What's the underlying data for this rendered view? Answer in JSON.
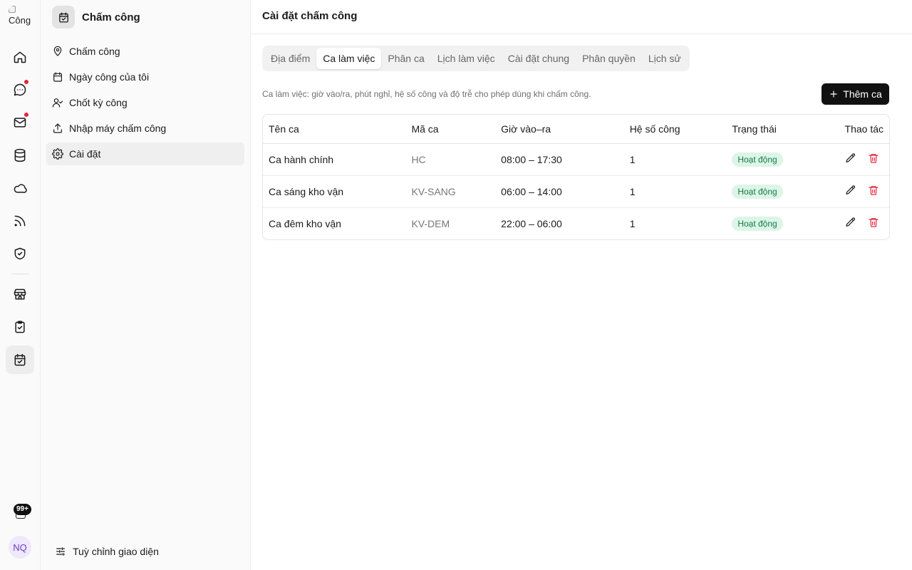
{
  "rail": {
    "logo_alt": "Công",
    "items": [
      {
        "icon": "home-icon"
      },
      {
        "icon": "chat-icon",
        "has_dot": true
      },
      {
        "icon": "mail-icon",
        "has_dot": true
      },
      {
        "icon": "database-icon"
      },
      {
        "icon": "cloud-icon"
      },
      {
        "icon": "rss-icon"
      },
      {
        "icon": "shield-check-icon"
      },
      {
        "icon": "store-icon"
      },
      {
        "icon": "clipboard-check-icon"
      },
      {
        "icon": "calendar-check-icon",
        "active": true
      }
    ],
    "notification_badge": "99+",
    "avatar_initials": "NQ"
  },
  "sidebar": {
    "title": "Chấm công",
    "items": [
      {
        "label": "Chấm công",
        "icon": "map-pin-icon"
      },
      {
        "label": "Ngày công của tôi",
        "icon": "calendar-icon"
      },
      {
        "label": "Chốt kỳ công",
        "icon": "user-check-icon"
      },
      {
        "label": "Nhập máy chấm công",
        "icon": "upload-icon"
      },
      {
        "label": "Cài đặt",
        "icon": "gear-icon",
        "active": true
      }
    ],
    "footer_label": "Tuỳ chỉnh giao diện"
  },
  "main": {
    "title": "Cài đặt chấm công",
    "tabs": [
      {
        "label": "Địa điểm"
      },
      {
        "label": "Ca làm việc",
        "active": true
      },
      {
        "label": "Phân ca"
      },
      {
        "label": "Lịch làm việc"
      },
      {
        "label": "Cài đặt chung"
      },
      {
        "label": "Phân quyền"
      },
      {
        "label": "Lịch sử"
      }
    ],
    "description": "Ca làm việc: giờ vào/ra, phút nghỉ, hệ số công và độ trễ cho phép dùng khi chấm công.",
    "add_button": "Thêm ca",
    "table": {
      "columns": [
        "Tên ca",
        "Mã ca",
        "Giờ vào–ra",
        "Hệ số công",
        "Trạng thái",
        "Thao tác"
      ],
      "rows": [
        {
          "name": "Ca hành chính",
          "code": "HC",
          "hours": "08:00 – 17:30",
          "factor": "1",
          "status": "Hoạt động"
        },
        {
          "name": "Ca sáng kho vận",
          "code": "KV-SANG",
          "hours": "06:00 – 14:00",
          "factor": "1",
          "status": "Hoạt động"
        },
        {
          "name": "Ca đêm kho vận",
          "code": "KV-DEM",
          "hours": "22:00 – 06:00",
          "factor": "1",
          "status": "Hoạt động"
        }
      ]
    }
  },
  "colors": {
    "primary_button": "#111111",
    "status_bg": "#dcf5e7",
    "status_text": "#137a46",
    "danger": "#e5243b",
    "notification_dot": "#e5243b"
  }
}
